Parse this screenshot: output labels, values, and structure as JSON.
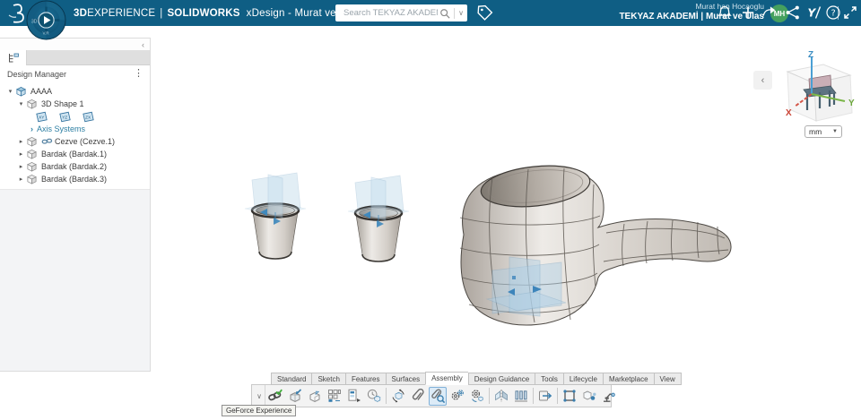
{
  "topbar": {
    "brand_3d": "3D",
    "brand_exp": "EXPERIENCE",
    "brand_sep": "|",
    "brand_sw": "SOLIDWORKS",
    "app_title": "xDesign - Murat ve Ulas",
    "search_placeholder": "Search TEKYAZ AKADEMI",
    "user_line1": "Murat han Hocaoglu",
    "user_line2": "TEKYAZ AKADEMİ | Murat ve Ulas",
    "avatar_initials": "MH",
    "bar_color": "#0f5e84"
  },
  "compass": {
    "west_label": "3D",
    "south_label": "V.R"
  },
  "sidebar": {
    "title": "Design Manager",
    "tree": [
      {
        "label": "AAAA",
        "depth": 0,
        "icon": "product",
        "caret": "expanded"
      },
      {
        "label": "3D Shape 1",
        "depth": 1,
        "icon": "shape",
        "caret": "expanded"
      },
      {
        "planes": [
          "XY",
          "YZ",
          "ZX"
        ],
        "depth": 2,
        "icon": "planes"
      },
      {
        "label": "Axis Systems",
        "depth": 2,
        "icon": "none",
        "caret": "link",
        "link_style": true
      },
      {
        "label": "Cezve (Cezve.1)",
        "depth": 1,
        "icon": "component",
        "caret": "collapsed",
        "link_badge": true
      },
      {
        "label": "Bardak (Bardak.1)",
        "depth": 1,
        "icon": "component",
        "caret": "collapsed"
      },
      {
        "label": "Bardak (Bardak.2)",
        "depth": 1,
        "icon": "component",
        "caret": "collapsed"
      },
      {
        "label": "Bardak (Bardak.3)",
        "depth": 1,
        "icon": "component",
        "caret": "collapsed"
      }
    ]
  },
  "viewport": {
    "unit": "mm"
  },
  "ribbon": {
    "tabs": [
      {
        "label": "Standard",
        "active": false
      },
      {
        "label": "Sketch",
        "active": false
      },
      {
        "label": "Features",
        "active": false
      },
      {
        "label": "Surfaces",
        "active": false
      },
      {
        "label": "Assembly",
        "active": true
      },
      {
        "label": "Design Guidance",
        "active": false
      },
      {
        "label": "Tools",
        "active": false
      },
      {
        "label": "Lifecycle",
        "active": false
      },
      {
        "label": "Marketplace",
        "active": false
      },
      {
        "label": "View",
        "active": false
      }
    ],
    "tool_groups": [
      [
        {
          "name": "mate",
          "icon": "chain-check"
        },
        {
          "name": "insert-component",
          "icon": "box-arrow"
        },
        {
          "name": "new-component",
          "icon": "box-arrow2"
        },
        {
          "name": "component-pattern",
          "icon": "grid"
        },
        {
          "name": "component-tree",
          "icon": "tree-list"
        },
        {
          "name": "component-history",
          "icon": "clock-cube"
        }
      ],
      [
        {
          "name": "move-component",
          "icon": "rotate-comp"
        },
        {
          "name": "attach",
          "icon": "paperclip"
        },
        {
          "name": "magnetic-mate",
          "icon": "magnet-clip",
          "selected": true
        },
        {
          "name": "gear-mate",
          "icon": "gears"
        },
        {
          "name": "mechanical-mate",
          "icon": "gear-arrow"
        }
      ],
      [
        {
          "name": "mirror-components",
          "icon": "mirror"
        },
        {
          "name": "pattern-components",
          "icon": "fence"
        }
      ],
      [
        {
          "name": "export-component",
          "icon": "export"
        }
      ],
      [
        {
          "name": "structure-frame",
          "icon": "frame"
        },
        {
          "name": "kinematics",
          "icon": "cube-balls"
        },
        {
          "name": "robot-programming",
          "icon": "robot"
        }
      ]
    ]
  },
  "tooltip": {
    "text": "GeForce Experience"
  },
  "colors": {
    "accent_blue": "#3b7fae",
    "avatar_green": "#45a05e",
    "selection": "#dcebf7"
  }
}
